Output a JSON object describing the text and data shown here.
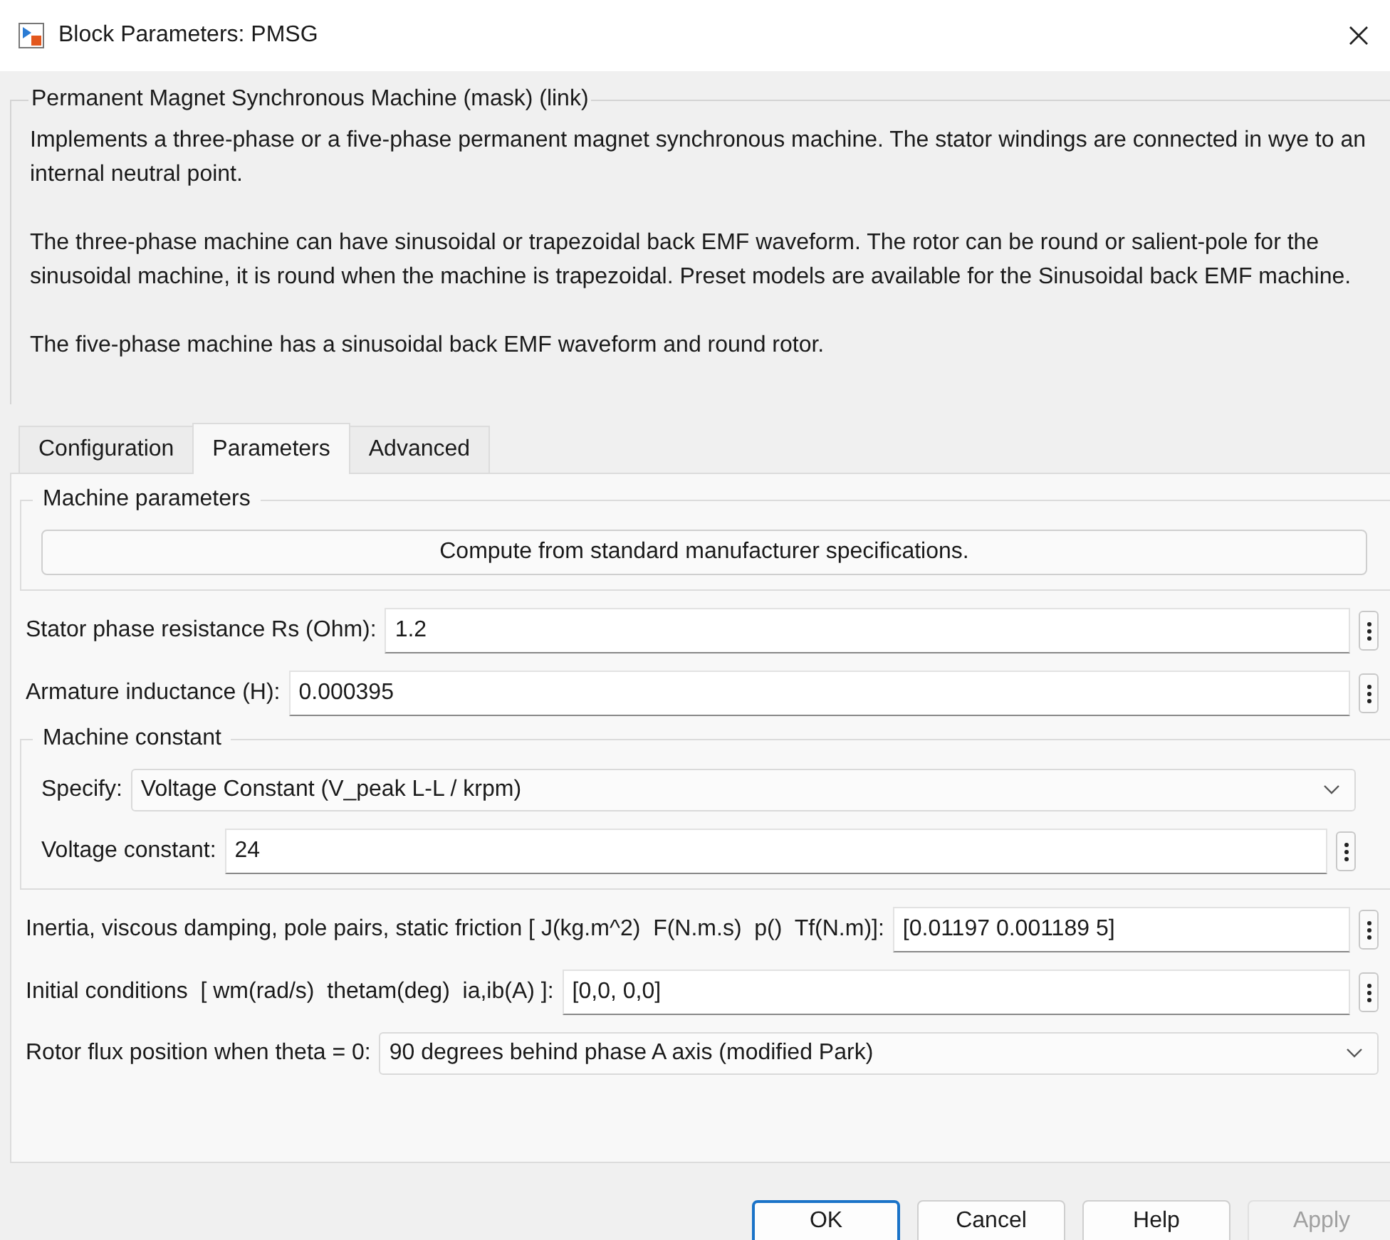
{
  "window": {
    "title": "Block Parameters: PMSG"
  },
  "description": {
    "title": "Permanent Magnet Synchronous Machine (mask) (link)",
    "paragraphs": [
      "Implements a three-phase or a five-phase permanent magnet synchronous machine. The stator windings are connected in wye to an internal neutral point.",
      "The three-phase machine can have sinusoidal or trapezoidal back EMF waveform. The rotor can be round or salient-pole for the sinusoidal machine, it is round when the machine is trapezoidal. Preset models are available for the Sinusoidal back EMF machine.",
      "The five-phase machine has a sinusoidal back EMF waveform and round rotor."
    ]
  },
  "tabs": [
    {
      "label": "Configuration",
      "selected": false
    },
    {
      "label": "Parameters",
      "selected": true
    },
    {
      "label": "Advanced",
      "selected": false
    }
  ],
  "parameters": [
    {
      "kind": "group",
      "title": "Machine parameters",
      "items": [
        {
          "kind": "button",
          "label": "Compute from standard manufacturer specifications."
        }
      ]
    },
    {
      "kind": "field",
      "label": "Stator phase resistance Rs (Ohm):",
      "value": "1.2"
    },
    {
      "kind": "field",
      "label": "Armature inductance (H):",
      "value": "0.000395"
    },
    {
      "kind": "group",
      "title": "Machine constant",
      "items": [
        {
          "kind": "dropdown",
          "label": "Specify:",
          "value": "Voltage Constant (V_peak L-L / krpm)"
        },
        {
          "kind": "field",
          "label": "Voltage constant:",
          "value": "24"
        }
      ]
    },
    {
      "kind": "field",
      "label": "Inertia, viscous damping, pole pairs, static friction [ J(kg.m^2)  F(N.m.s)  p()  Tf(N.m)]:",
      "value": "[0.01197 0.001189 5]"
    },
    {
      "kind": "field",
      "label": "Initial conditions  [ wm(rad/s)  thetam(deg)  ia,ib(A) ]:",
      "value": "[0,0, 0,0]"
    },
    {
      "kind": "dropdown",
      "label": "Rotor flux position when theta = 0:",
      "value": "90 degrees behind phase A axis (modified Park)"
    }
  ],
  "buttons": [
    {
      "label": "OK",
      "default": true,
      "disabled": false
    },
    {
      "label": "Cancel",
      "default": false,
      "disabled": false
    },
    {
      "label": "Help",
      "default": false,
      "disabled": false
    },
    {
      "label": "Apply",
      "default": false,
      "disabled": true
    }
  ]
}
